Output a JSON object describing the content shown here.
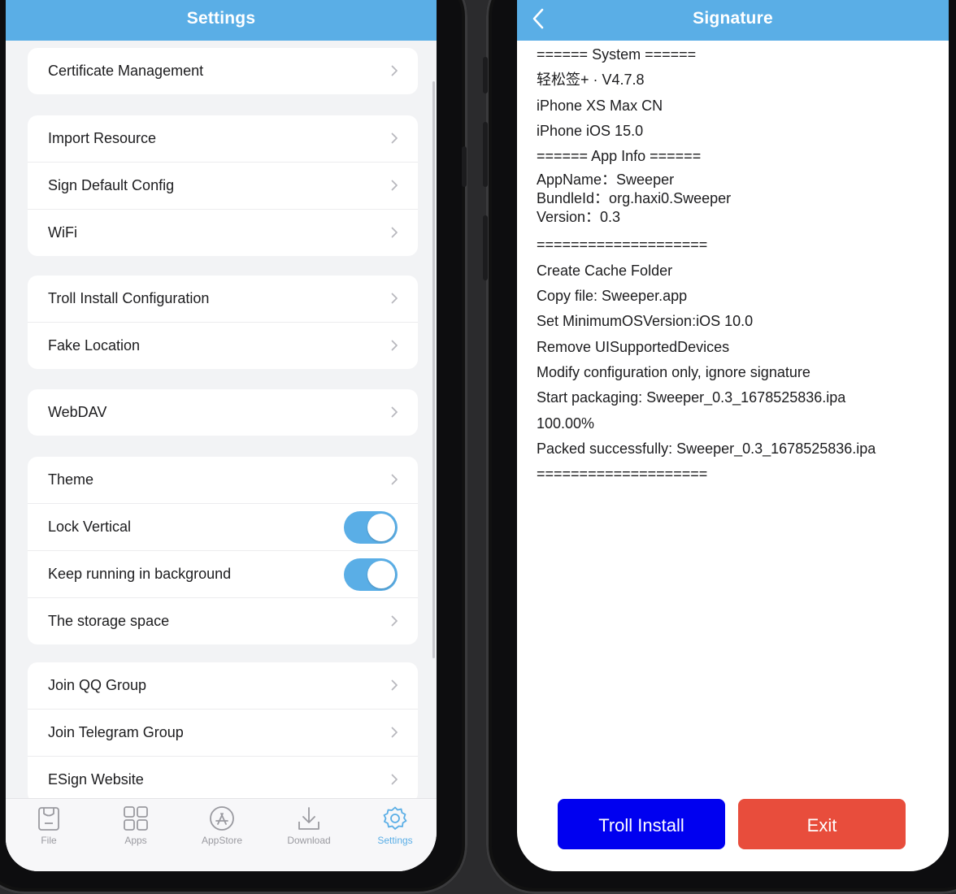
{
  "settings": {
    "title": "Settings",
    "groups": [
      {
        "items": [
          {
            "label": "Certificate Management"
          }
        ]
      },
      {
        "items": [
          {
            "label": "Import Resource"
          },
          {
            "label": "Sign Default Config"
          },
          {
            "label": "WiFi"
          }
        ]
      },
      {
        "items": [
          {
            "label": "Troll Install Configuration"
          },
          {
            "label": "Fake Location"
          }
        ]
      },
      {
        "items": [
          {
            "label": "WebDAV"
          }
        ]
      },
      {
        "items": [
          {
            "label": "Theme"
          },
          {
            "label": "Lock Vertical",
            "toggle": true
          },
          {
            "label": "Keep running in background",
            "toggle": true
          },
          {
            "label": "The storage space"
          }
        ]
      },
      {
        "items": [
          {
            "label": "Join QQ Group"
          },
          {
            "label": "Join Telegram Group"
          },
          {
            "label": "ESign Website"
          }
        ]
      }
    ],
    "tabs": [
      {
        "label": "File",
        "icon": "file-icon"
      },
      {
        "label": "Apps",
        "icon": "apps-grid-icon"
      },
      {
        "label": "AppStore",
        "icon": "appstore-icon"
      },
      {
        "label": "Download",
        "icon": "download-icon"
      },
      {
        "label": "Settings",
        "icon": "gear-icon",
        "active": true
      }
    ]
  },
  "signature": {
    "title": "Signature",
    "log": [
      "====== System ======",
      "轻松签+ · V4.7.8",
      "iPhone XS Max CN",
      "iPhone iOS 15.0",
      "====== App Info ======",
      "AppName：Sweeper",
      "BundleId：org.haxi0.Sweeper",
      "Version：0.3",
      "====================",
      "Create Cache Folder",
      "Copy file: Sweeper.app",
      "Set MinimumOSVersion:iOS 10.0",
      "Remove UISupportedDevices",
      "Modify configuration only, ignore signature",
      "Start packaging: Sweeper_0.3_1678525836.ipa",
      "100.00%",
      "Packed successfully: Sweeper_0.3_1678525836.ipa",
      "===================="
    ],
    "buttons": {
      "troll_install": "Troll Install",
      "exit": "Exit"
    }
  },
  "colors": {
    "accent": "#5aaee6",
    "troll_button": "#0000f0",
    "exit_button": "#e84d3c"
  }
}
